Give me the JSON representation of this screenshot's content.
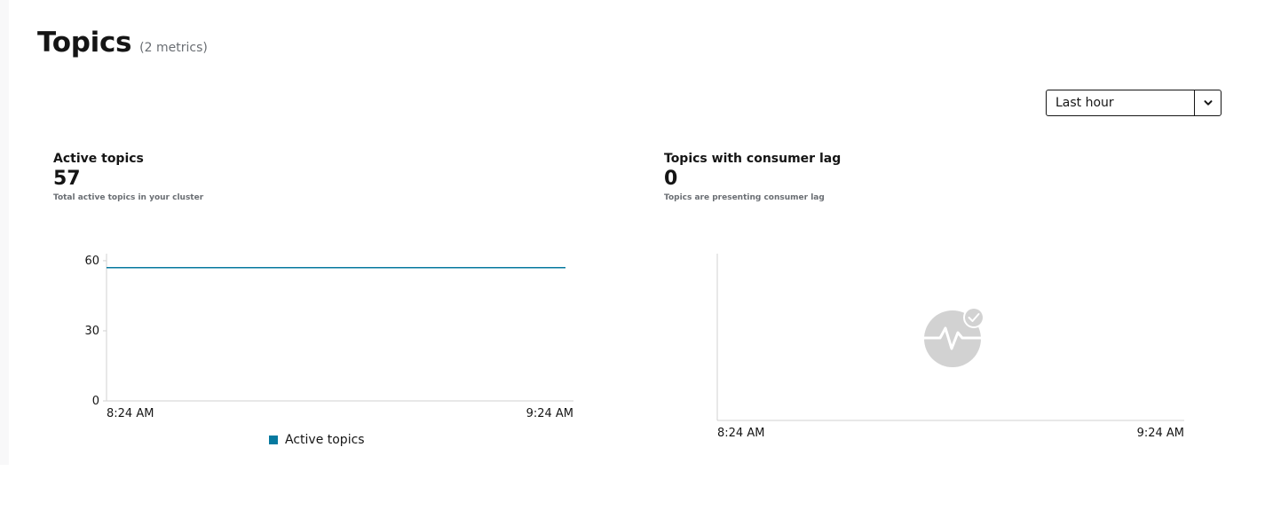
{
  "header": {
    "title": "Topics",
    "subtitle": "(2 metrics)"
  },
  "time_range": {
    "selected": "Last hour",
    "toggle_icon": "chevron-down-icon"
  },
  "cards": [
    {
      "title": "Active topics",
      "value": "57",
      "description": "Total active topics in your cluster"
    },
    {
      "title": "Topics with consumer lag",
      "value": "0",
      "description": "Topics are presenting consumer lag",
      "empty_state_icon": "activity-check-icon"
    }
  ],
  "colors": {
    "series": "#06799f",
    "axis": "#d2d2d2",
    "empty_icon": "#d2d2d2"
  },
  "chart_data": [
    {
      "type": "line",
      "x": [
        "8:24 AM",
        "9:24 AM"
      ],
      "series": [
        {
          "name": "Active topics",
          "values": [
            57,
            57
          ]
        }
      ],
      "yticks": [
        "0",
        "30",
        "60"
      ],
      "ylim": [
        0,
        63
      ],
      "legend": "bottom"
    },
    {
      "type": "line",
      "x": [
        "8:24 AM",
        "9:24 AM"
      ],
      "series": [],
      "legend": "none"
    }
  ]
}
